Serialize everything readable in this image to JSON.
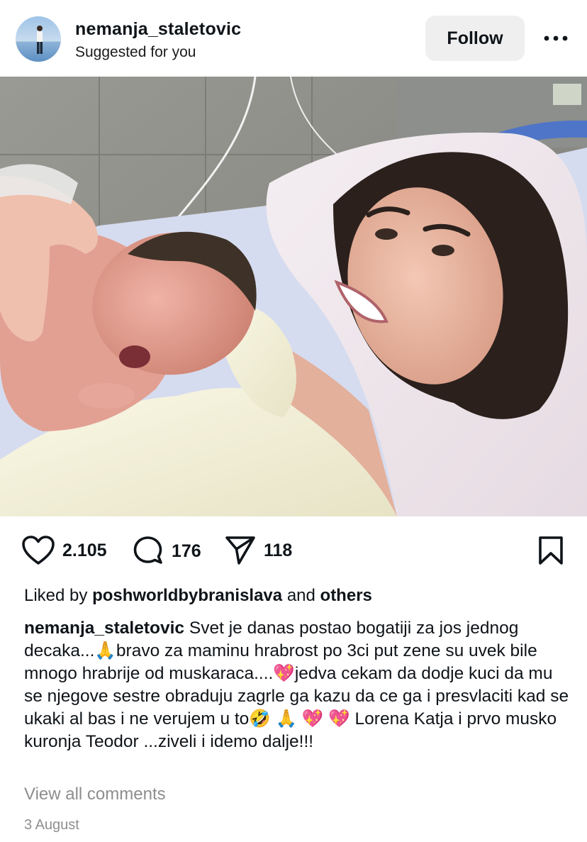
{
  "header": {
    "username": "nemanja_staletovic",
    "subtitle": "Suggested for you",
    "follow_label": "Follow"
  },
  "photo": {
    "alt_colors": {
      "wall": "#8e8e88",
      "pillow": "#f1e9ee",
      "blanket": "#f4f1dc",
      "hair": "#2b201c",
      "skin": "#e9b8a4"
    }
  },
  "actions": {
    "likes_count": "2.105",
    "comments_count": "176",
    "shares_count": "118"
  },
  "liked_by": {
    "prefix": "Liked by",
    "user": "poshworldbybranislava",
    "conj": "and",
    "others": "others"
  },
  "caption": {
    "user": "nemanja_staletovic",
    "text": "Svet je danas postao bogatiji za jos jednog decaka...🙏bravo za maminu hrabrost po 3ci put zene su uvek bile mnogo hrabrije od muskaraca....💖jedva cekam da dodje kuci da mu se njegove sestre obraduju zagrle ga kazu da ce ga i presvlaciti kad se ukaki al bas i ne verujem u to🤣 🙏 💖 💖 Lorena Katja i prvo musko kuronja Teodor ...ziveli i idemo dalje!!!"
  },
  "view_all_comments": "View all comments",
  "date": "3 August"
}
